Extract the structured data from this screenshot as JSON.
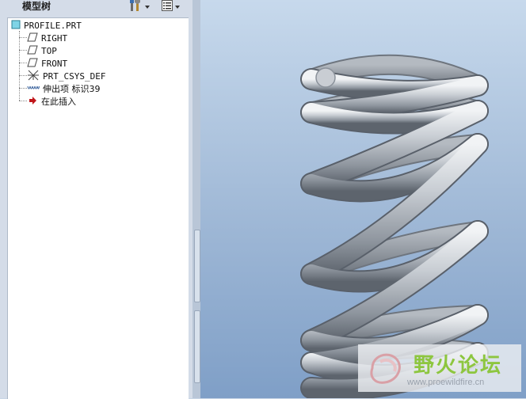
{
  "panel": {
    "title": "模型树",
    "toolbar": [
      {
        "icon": "settings-tools-icon"
      },
      {
        "icon": "tree-columns-icon"
      }
    ]
  },
  "tree": {
    "items": [
      {
        "label": "PROFILE.PRT",
        "icon": "part-icon"
      },
      {
        "label": "RIGHT",
        "icon": "datum-plane-icon"
      },
      {
        "label": "TOP",
        "icon": "datum-plane-icon"
      },
      {
        "label": "FRONT",
        "icon": "datum-plane-icon"
      },
      {
        "label": "PRT_CSYS_DEF",
        "icon": "coordinate-system-icon"
      },
      {
        "label": "伸出项 标识39",
        "icon": "protrusion-icon"
      },
      {
        "label": "在此插入",
        "icon": "insert-here-arrow-icon"
      }
    ]
  },
  "watermark": {
    "title": "野火论坛",
    "url": "www.proewildfire.cn"
  },
  "colors": {
    "viewport_top": "#c7d9ec",
    "viewport_bottom": "#7f9fc7",
    "spring": "#b8bdc4",
    "watermark_green": "#8dc63f"
  }
}
